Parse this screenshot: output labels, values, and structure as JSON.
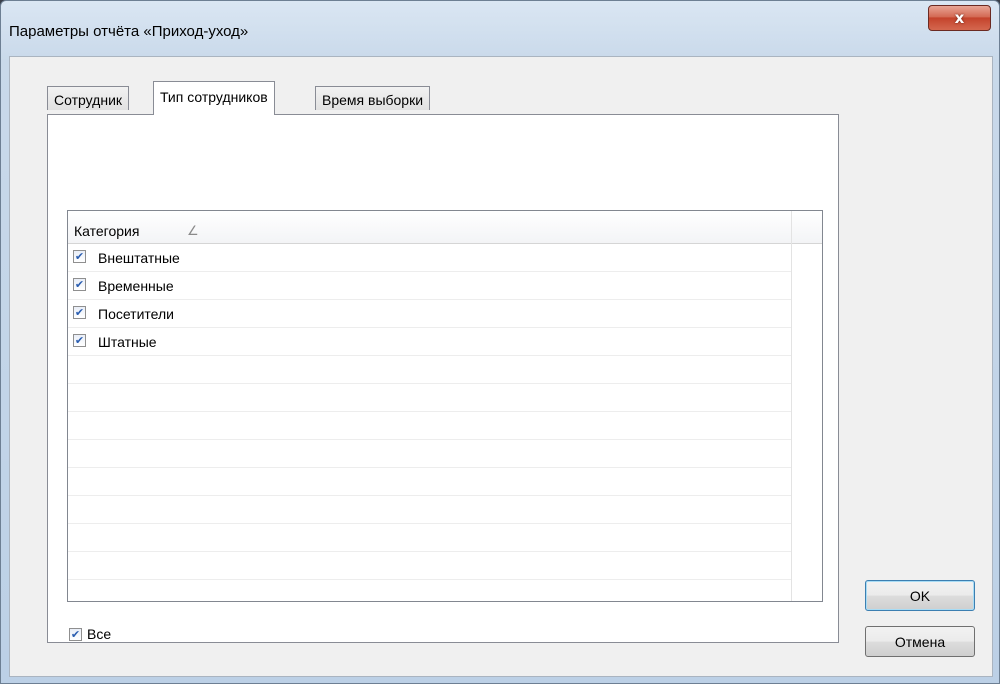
{
  "window": {
    "title": "Параметры отчёта «Приход-уход»",
    "close_glyph": "x"
  },
  "tabs": [
    {
      "label": "Сотрудник",
      "active": false
    },
    {
      "label": "Тип сотрудников",
      "active": true
    },
    {
      "label": "Время выборки",
      "active": false
    }
  ],
  "grid": {
    "column_header": "Категория",
    "sort_icon": "sort-ascending-icon",
    "rows": [
      {
        "label": "Внештатные",
        "checked": true
      },
      {
        "label": "Временные",
        "checked": true
      },
      {
        "label": "Посетители",
        "checked": true
      },
      {
        "label": "Штатные",
        "checked": true
      }
    ]
  },
  "all_checkbox": {
    "label": "Все",
    "checked": true
  },
  "buttons": {
    "ok_label": "OK",
    "cancel_label": "Отмена"
  }
}
